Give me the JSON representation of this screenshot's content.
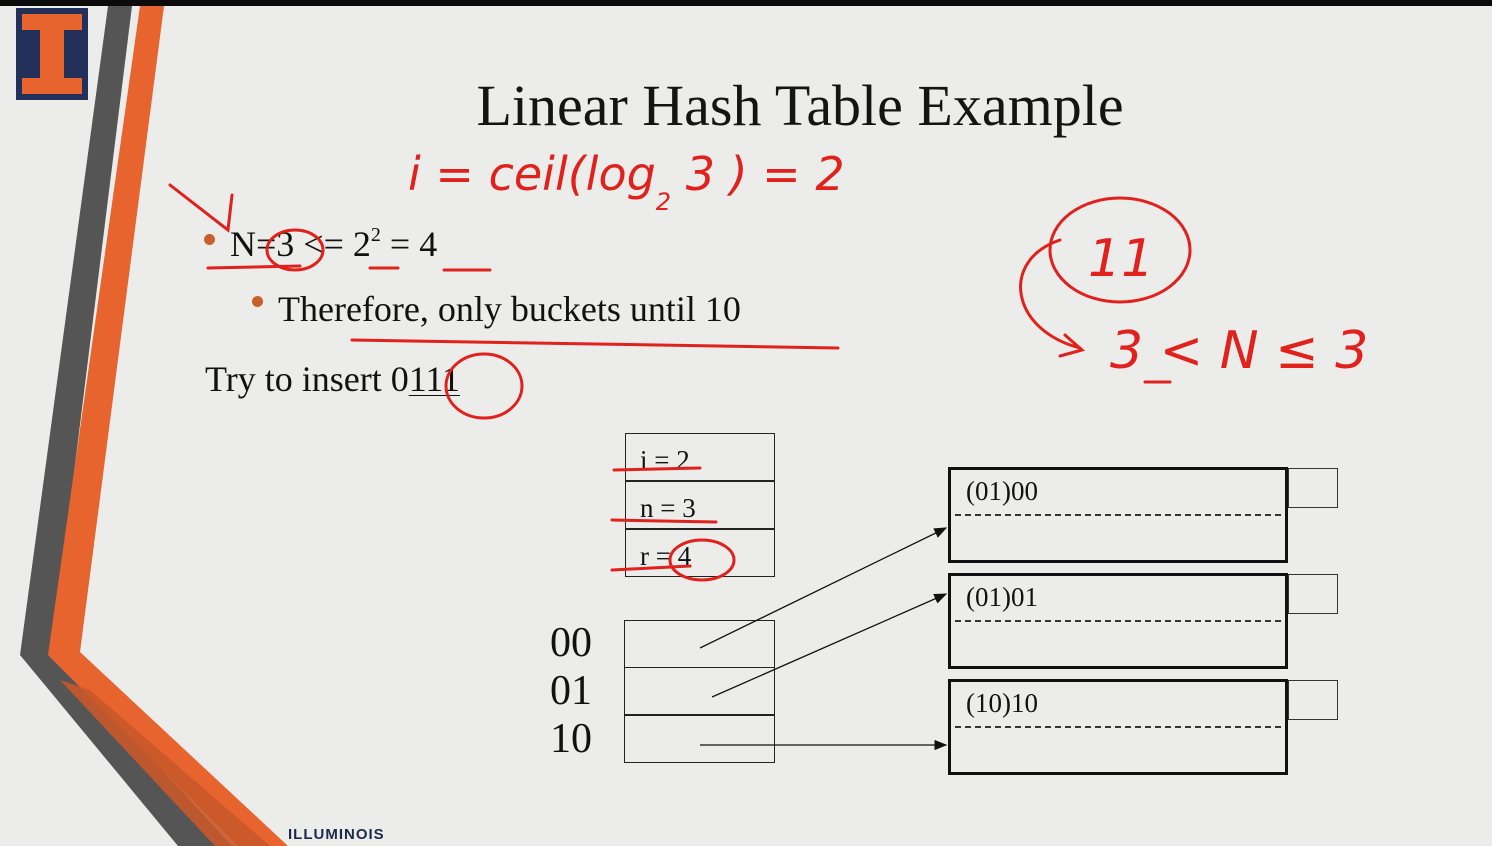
{
  "slide": {
    "title": "Linear Hash Table Example",
    "bullet1": {
      "text_before": "N=3 <= 2",
      "sup": "2",
      "text_after": " = 4"
    },
    "bullet2": "Therefore, only buckets until 10",
    "try_prefix": "Try to insert 0",
    "try_suffix": "111",
    "footer_brand": "ILLUMINOIS",
    "footer_logo": "I"
  },
  "info_boxes": [
    "i = 2",
    "n = 3",
    "r = 4"
  ],
  "directory": [
    "00",
    "01",
    "10"
  ],
  "buckets": [
    "(01)00",
    "(01)01",
    "(10)10"
  ],
  "annotations": {
    "formula_ceil": "i = ceil(log",
    "formula_sub": "2",
    "formula_arg": " 3 ) = 2",
    "circled": "11",
    "inequality": "3 < N ≤ 3"
  },
  "colors": {
    "accent_orange": "#e8642e",
    "accent_gray": "#5a5a5a",
    "ink_red": "#e0211c"
  }
}
